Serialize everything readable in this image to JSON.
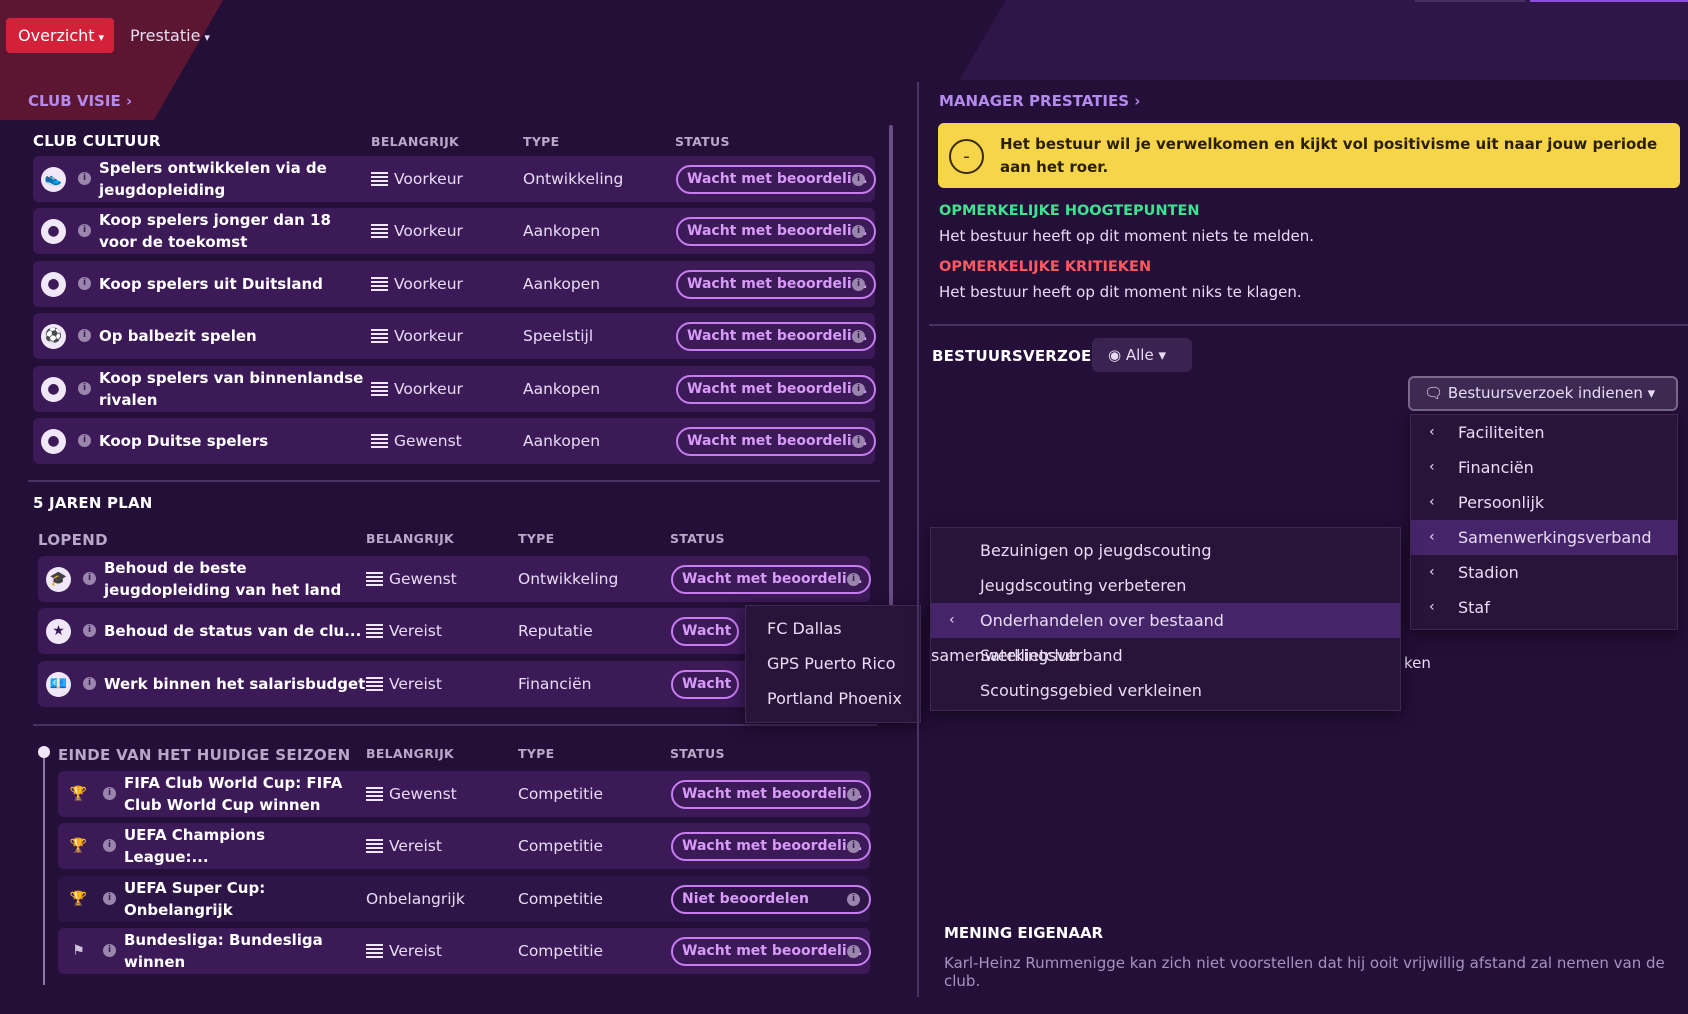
{
  "tabs": [
    {
      "label": "Overzicht"
    },
    {
      "label": "Prestatie"
    }
  ],
  "left": {
    "section_title": "CLUB VISIE",
    "culture": {
      "title": "CLUB CULTUUR",
      "col_importance": "BELANGRIJK",
      "col_type": "TYPE",
      "col_status": "STATUS",
      "rows": [
        {
          "icon": "boot-icon",
          "title": "Spelers ontwikkelen via de jeugdopleiding",
          "importance": "Voorkeur",
          "type": "Ontwikkeling",
          "status": "Wacht met beoordeli..."
        },
        {
          "icon": "person-icon",
          "title": "Koop spelers jonger dan 18 voor de toekomst",
          "importance": "Voorkeur",
          "type": "Aankopen",
          "status": "Wacht met beoordeli..."
        },
        {
          "icon": "person-icon",
          "title": "Koop spelers uit Duitsland",
          "importance": "Voorkeur",
          "type": "Aankopen",
          "status": "Wacht met beoordeli..."
        },
        {
          "icon": "ball-icon",
          "title": "Op balbezit spelen",
          "importance": "Voorkeur",
          "type": "Speelstijl",
          "status": "Wacht met beoordeli..."
        },
        {
          "icon": "person-icon",
          "title": "Koop spelers van binnenlandse rivalen",
          "importance": "Voorkeur",
          "type": "Aankopen",
          "status": "Wacht met beoordeli..."
        },
        {
          "icon": "person-icon",
          "title": "Koop Duitse spelers",
          "importance": "Gewenst",
          "type": "Aankopen",
          "status": "Wacht met beoordeli..."
        }
      ]
    },
    "plan": {
      "title": "5 JAREN PLAN",
      "ongoing_title": "LOPEND",
      "col_importance": "BELANGRIJK",
      "col_type": "TYPE",
      "col_status": "STATUS",
      "rows": [
        {
          "icon": "graduation-icon",
          "title": "Behoud de beste jeugdopleiding van het land",
          "importance": "Gewenst",
          "type": "Ontwikkeling",
          "status": "Wacht met beoordeli..."
        },
        {
          "icon": "star-icon",
          "title": "Behoud de status van de clu...",
          "importance": "Vereist",
          "type": "Reputatie",
          "status": "Wacht met beoordeli..."
        },
        {
          "icon": "money-icon",
          "title": "Werk binnen het salarisbudget",
          "importance": "Vereist",
          "type": "Financiën",
          "status": "Wacht met beoordeli..."
        }
      ],
      "season_title": "EINDE VAN HET HUIDIGE SEIZOEN",
      "season_rows": [
        {
          "icon": "trophy-icon",
          "title": "FIFA Club World Cup: FIFA Club World Cup winnen",
          "importance": "Gewenst",
          "type": "Competitie",
          "status": "Wacht met beoordeli..."
        },
        {
          "icon": "trophy-icon",
          "title": "UEFA Champions League:...",
          "importance": "Vereist",
          "type": "Competitie",
          "status": "Wacht met beoordeli..."
        },
        {
          "icon": "trophy-icon",
          "title": "UEFA Super Cup: Onbelangrijk",
          "importance": "Onbelangrijk",
          "type": "Competitie",
          "status": "Niet beoordelen"
        },
        {
          "icon": "bundesliga-icon",
          "title": "Bundesliga: Bundesliga winnen",
          "importance": "Vereist",
          "type": "Competitie",
          "status": "Wacht met beoordeli..."
        }
      ]
    },
    "club_popup": [
      "FC Dallas",
      "GPS Puerto Rico",
      "Portland Phoenix"
    ]
  },
  "right": {
    "section_title": "MANAGER PRESTATIES",
    "banner_text": "Het bestuur wil je verwelkomen en kijkt vol positivisme uit naar jouw periode aan het roer.",
    "banner_symbol": "-",
    "highlights_title": "OPMERKELIJKE HOOGTEPUNTEN",
    "highlights_text": "Het bestuur heeft op dit moment niets te melden.",
    "critics_title": "OPMERKELIJKE KRITIEKEN",
    "critics_text": "Het bestuur heeft op dit moment niks te klagen.",
    "request_title": "BESTUURSVERZOEK",
    "filter_label": "Alle",
    "submit_label": "Bestuursverzoek indienen",
    "categories": [
      "Faciliteiten",
      "Financiën",
      "Persoonlijk",
      "Samenwerkingsverband",
      "Stadion",
      "Staf"
    ],
    "submenu": [
      "Bezuinigen op jeugdscouting",
      "Jeugdscouting verbeteren",
      "Onderhandelen over bestaand samenwerkingsverband",
      "Satellietclub",
      "Scoutingsgebied verkleinen"
    ],
    "hidden_fragment": "ken",
    "owner_title": "MENING EIGENAAR",
    "owner_text": "Karl-Heinz Rummenigge kan zich niet voorstellen dat hij ooit vrijwillig afstand zal nemen van de club."
  },
  "colors": {
    "accent": "#d4213a",
    "purple": "#b48aec",
    "banner": "#f6d54a",
    "green": "#3fe38f",
    "red": "#ff5960"
  }
}
